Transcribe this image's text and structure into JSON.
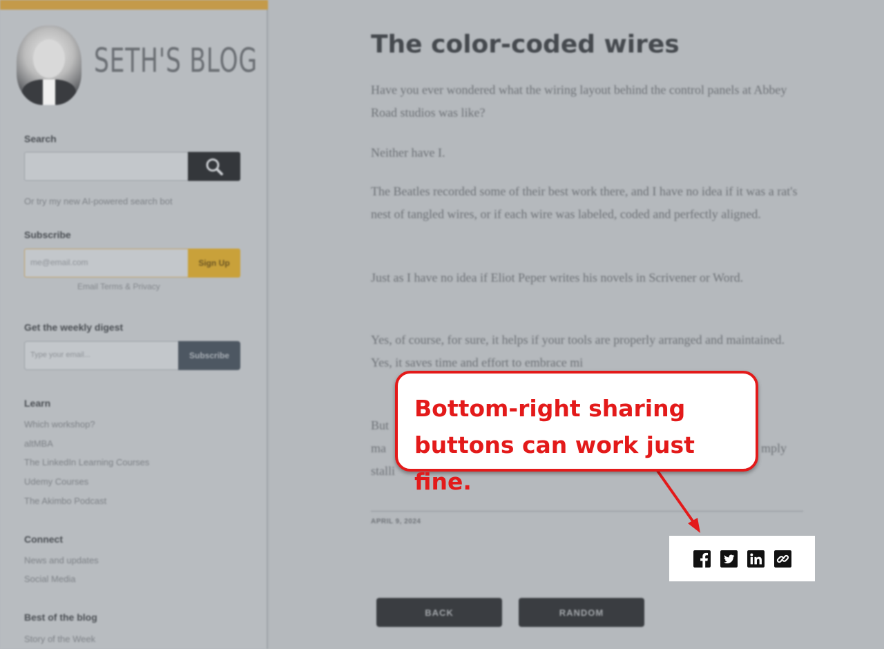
{
  "sidebar": {
    "logo_text": "SETH'S BLOG",
    "search": {
      "label": "Search",
      "hint": "Or try my new AI-powered search bot"
    },
    "subscribe": {
      "label": "Subscribe",
      "email_placeholder": "me@email.com",
      "button": "Sign Up",
      "terms": "Email Terms & Privacy"
    },
    "digest": {
      "label": "Get the weekly digest",
      "placeholder": "Type your email...",
      "button": "Subscribe"
    },
    "learn": {
      "label": "Learn",
      "links": [
        "Which workshop?",
        "altMBA",
        "The LinkedIn Learning Courses",
        "Udemy Courses",
        "The Akimbo Podcast"
      ]
    },
    "connect": {
      "label": "Connect",
      "links": [
        "News and updates",
        "Social Media"
      ]
    },
    "best": {
      "label": "Best of the blog",
      "links": [
        "Story of the Week"
      ]
    }
  },
  "article": {
    "title": "The color-coded wires",
    "paragraphs": [
      "Have you ever wondered what the wiring layout behind the control panels at Abbey Road studios was like?",
      "Neither have I.",
      "The Beatles recorded some of their best work there, and I have no idea if it was a rat's nest of tangled wires, or if each wire was labeled, coded and perfectly aligned.",
      "Just as I have no idea if Eliot Peper writes his novels in Scrivener or Word.",
      "Yes, of course, for sure, it helps if your tools are properly arranged and maintained. Yes, it saves time and effort to embrace mi",
      "But",
      "ma",
      "mply",
      "stalli"
    ],
    "date": "APRIL 9, 2024",
    "nav": {
      "back": "BACK",
      "random": "RANDOM"
    }
  },
  "share": {
    "icons": [
      "facebook-icon",
      "twitter-icon",
      "linkedin-icon",
      "link-icon"
    ]
  },
  "callout": {
    "line1": "Bottom-right sharing",
    "line2": "buttons can work just fine.",
    "color": "#e31a1a"
  }
}
